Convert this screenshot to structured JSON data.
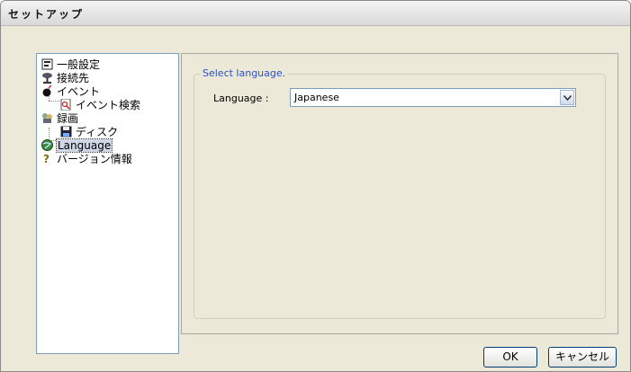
{
  "window": {
    "title": "セットアップ"
  },
  "tree": {
    "items": [
      {
        "label": "一般設定",
        "icon": "settings-panel-icon"
      },
      {
        "label": "接続先",
        "icon": "network-icon"
      },
      {
        "label": "イベント",
        "icon": "event-bomb-icon"
      },
      {
        "label": "イベント検索",
        "icon": "search-document-icon"
      },
      {
        "label": "録画",
        "icon": "recording-icon"
      },
      {
        "label": "ディスク",
        "icon": "disk-icon"
      },
      {
        "label": "Language",
        "icon": "globe-icon",
        "selected": true
      },
      {
        "label": "バージョン情報",
        "icon": "question-icon"
      }
    ]
  },
  "panel": {
    "group_title": "Select language.",
    "language_label": "Language :",
    "language_value": "Japanese"
  },
  "buttons": {
    "ok": "OK",
    "cancel": "キャンセル"
  }
}
